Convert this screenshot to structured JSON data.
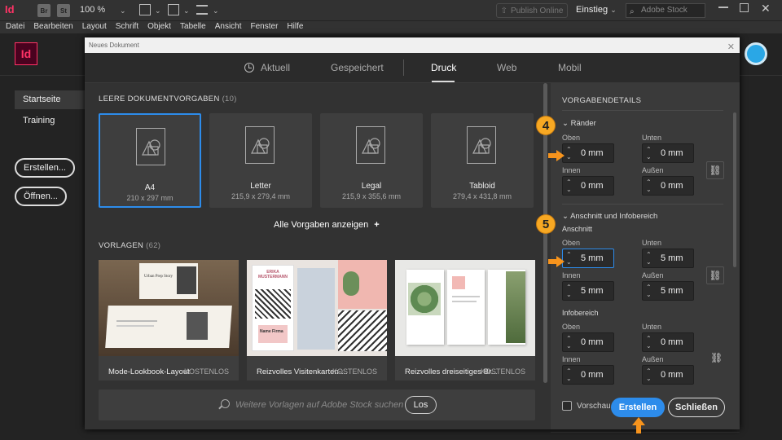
{
  "appbar": {
    "logo": "Id",
    "bridge": "Br",
    "stock_btn": "St",
    "zoom": "100 %",
    "publish": "Publish Online",
    "workspace": "Einstieg",
    "search_placeholder": "Adobe Stock"
  },
  "menu": [
    "Datei",
    "Bearbeiten",
    "Layout",
    "Schrift",
    "Objekt",
    "Tabelle",
    "Ansicht",
    "Fenster",
    "Hilfe"
  ],
  "home": {
    "logo": "Id",
    "sidebar": [
      {
        "label": "Startseite"
      },
      {
        "label": "Training"
      }
    ],
    "create_btn": "Erstellen...",
    "open_btn": "Öffnen..."
  },
  "dialog": {
    "title": "Neues Dokument",
    "tabs": [
      {
        "label": "Aktuell"
      },
      {
        "label": "Gespeichert"
      },
      {
        "label": "Druck"
      },
      {
        "label": "Web"
      },
      {
        "label": "Mobil"
      }
    ],
    "presets_heading": "LEERE DOKUMENTVORGABEN",
    "presets_count": "(10)",
    "presets": [
      {
        "name": "A4",
        "dim": "210 x 297 mm"
      },
      {
        "name": "Letter",
        "dim": "215,9 x 279,4 mm"
      },
      {
        "name": "Legal",
        "dim": "215,9 x 355,6 mm"
      },
      {
        "name": "Tabloid",
        "dim": "279,4 x 431,8 mm"
      }
    ],
    "all_presets": "Alle Vorgaben anzeigen",
    "templates_heading": "VORLAGEN",
    "templates_count": "(62)",
    "templates": [
      {
        "name": "Mode-Lookbook-Layout",
        "price": "KOSTENLOS",
        "thumb_title": "Urban Prep Story"
      },
      {
        "name": "Reizvolles Visitenkarten-...",
        "price": "KOSTENLOS",
        "thumb_title": "ERIKA MUSTERMANN",
        "thumb_sub": "Name Firma"
      },
      {
        "name": "Reizvolles dreiseitiges Br...",
        "price": "KOSTENLOS"
      }
    ],
    "search_placeholder": "Weitere Vorlagen auf Adobe Stock suchen",
    "search_btn": "Los"
  },
  "panel": {
    "title": "VORGABENDETAILS",
    "margins_heading": "Ränder",
    "bleed_heading": "Anschnitt und Infobereich",
    "bleed_label": "Anschnitt",
    "slug_label": "Infobereich",
    "labels": {
      "top": "Oben",
      "bottom": "Unten",
      "inside": "Innen",
      "outside": "Außen"
    },
    "margins": {
      "top": "0 mm",
      "bottom": "0 mm",
      "inside": "0 mm",
      "outside": "0 mm"
    },
    "bleed": {
      "top": "5 mm",
      "bottom": "5 mm",
      "inside": "5 mm",
      "outside": "5 mm"
    },
    "slug": {
      "top": "0 mm",
      "bottom": "0 mm",
      "inside": "0 mm",
      "outside": "0 mm"
    },
    "preview_label": "Vorschau",
    "create_btn": "Erstellen",
    "close_btn": "Schließen"
  },
  "callouts": [
    "4",
    "5"
  ],
  "colors": {
    "accent": "#2d8ceb",
    "callout": "#f7a823",
    "indesign": "#ff3366"
  }
}
